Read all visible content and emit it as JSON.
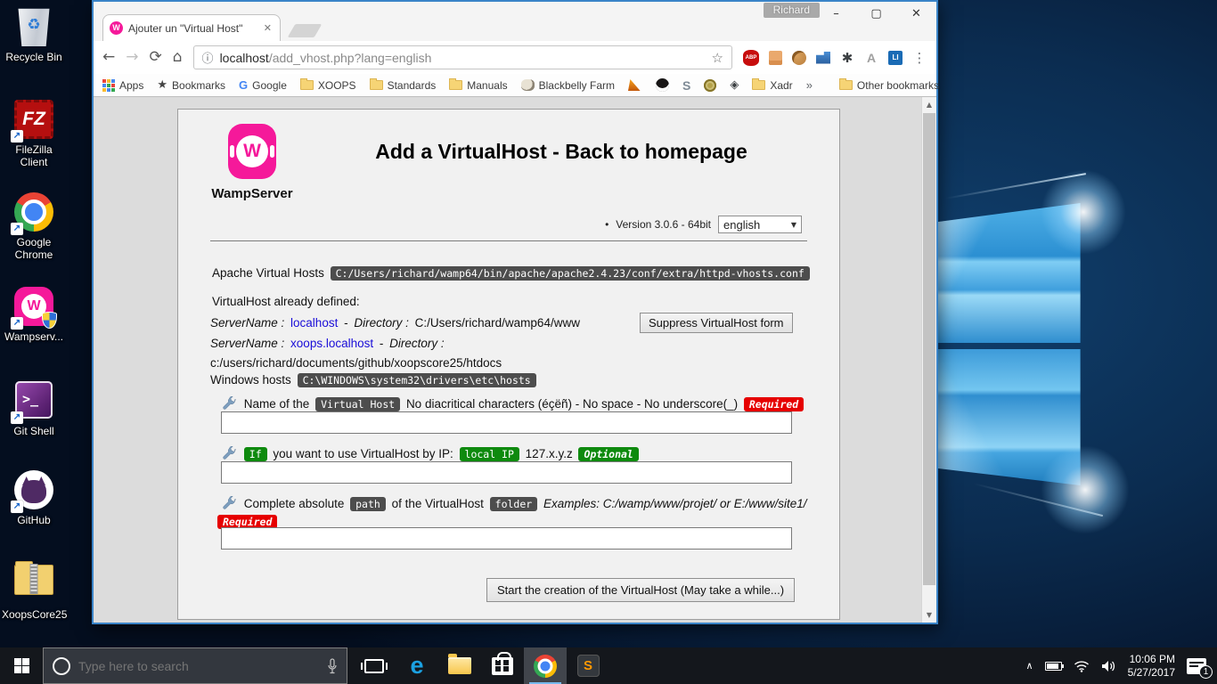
{
  "desktop": {
    "icons": [
      {
        "label": "Recycle Bin",
        "icon": "recycle-bin-icon"
      },
      {
        "label": "FileZilla Client",
        "icon": "filezilla-icon",
        "glyph": "FZ"
      },
      {
        "label": "Google Chrome",
        "icon": "chrome-icon"
      },
      {
        "label": "Wampserv...",
        "icon": "wampserver-icon",
        "glyph": "W"
      },
      {
        "label": "Git Shell",
        "icon": "git-shell-icon",
        "glyph": ">_"
      },
      {
        "label": "GitHub",
        "icon": "github-icon"
      },
      {
        "label": "XoopsCore25",
        "icon": "zip-folder-icon"
      }
    ],
    "recycle_glyph": "♻"
  },
  "browser": {
    "profile_name": "Richard",
    "window_controls": {
      "minimize": "–",
      "maximize": "▢",
      "close": "✕"
    },
    "tab": {
      "title": "Ajouter un \"Virtual Host\"",
      "favicon_letter": "W",
      "close_glyph": "✕"
    },
    "nav": {
      "back": "←",
      "forward": "→",
      "reload": "⟳",
      "home": "⌂"
    },
    "omnibox": {
      "info_glyph": "ⓘ",
      "url_host": "localhost",
      "url_path": "/add_vhost.php?lang=english",
      "star_glyph": "☆"
    },
    "extensions": {
      "abp": "ABP",
      "a_letter": "A",
      "li": "LI",
      "bug_glyph": "✱",
      "menu_glyph": "⋮"
    },
    "bookmarks_bar": {
      "apps": "Apps",
      "bookmarks": "Bookmarks",
      "star_glyph": "★",
      "google_letter": "G",
      "google": "Google",
      "xoops": "XOOPS",
      "standards": "Standards",
      "manuals": "Manuals",
      "blackbelly": "Blackbelly Farm",
      "s_letter": "S",
      "diamond_glyph": "◈",
      "xadr": "Xadr",
      "overflow": "»",
      "other": "Other bookmarks"
    }
  },
  "page": {
    "brand": "WampServer",
    "logo_letter": "W",
    "heading": "Add a VirtualHost - Back to homepage",
    "version_bullet": "•",
    "version_text": "Version 3.0.6 - 64bit",
    "language_selected": "english",
    "select_arrow": "▼",
    "apache_label": "Apache Virtual Hosts",
    "apache_path": "C:/Users/richard/wamp64/bin/apache/apache2.4.23/conf/extra/httpd-vhosts.conf",
    "defined_heading": "VirtualHost already defined:",
    "vhost1": {
      "k1": "ServerName :",
      "name": "localhost",
      "sep": "-",
      "k2": "Directory :",
      "dir": "C:/Users/richard/wamp64/www"
    },
    "vhost2": {
      "k1": "ServerName :",
      "name": "xoops.localhost",
      "sep": "-",
      "k2": "Directory :"
    },
    "vhost2_dir": "c:/users/richard/documents/github/xoopscore25/htdocs",
    "suppress_button": "Suppress VirtualHost form",
    "hosts_label": "Windows hosts",
    "hosts_path": "C:\\WINDOWS\\system32\\drivers\\etc\\hosts",
    "field_name": {
      "pre": "Name of the",
      "badge": "Virtual Host",
      "post": "No diacritical characters (éçëñ) - No space - No underscore(_)",
      "required": "Required"
    },
    "field_ip": {
      "badge_if": "If",
      "t1": "you want to use VirtualHost by IP:",
      "badge_ip": "local IP",
      "t2": "127.x.y.z",
      "optional": "Optional"
    },
    "field_path": {
      "pre": "Complete absolute",
      "badge_path": "path",
      "mid": "of the VirtualHost",
      "badge_folder": "folder",
      "examples": "Examples: C:/wamp/www/projet/ or E:/www/site1/",
      "required": "Required"
    },
    "submit_button": "Start the creation of the VirtualHost (May take a while...)",
    "scroll_up_glyph": "▲",
    "scroll_down_glyph": "▼"
  },
  "taskbar": {
    "search_placeholder": "Type here to search",
    "edge_letter": "e",
    "sublime_letter": "S",
    "tray_chevron": "∧",
    "clock": {
      "time": "10:06 PM",
      "date": "5/27/2017"
    },
    "notification_count": "1"
  }
}
